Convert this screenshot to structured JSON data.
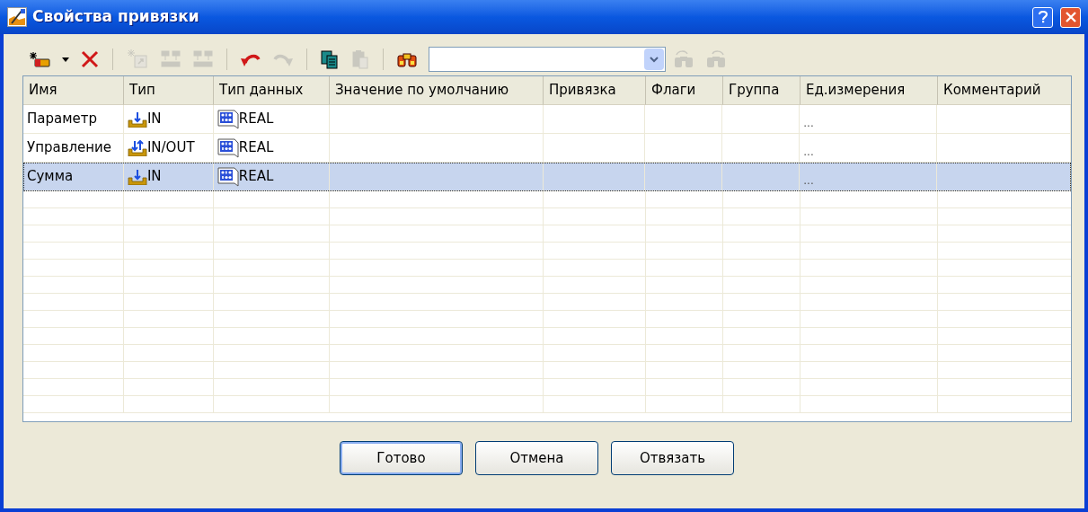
{
  "window": {
    "title": "Свойства привязки"
  },
  "toolbar": [
    {
      "kind": "new",
      "disabled": false
    },
    {
      "kind": "dropdown",
      "disabled": false
    },
    {
      "kind": "delete",
      "disabled": false
    },
    {
      "kind": "separator"
    },
    {
      "kind": "import",
      "disabled": true
    },
    {
      "kind": "group",
      "disabled": true
    },
    {
      "kind": "ungroup",
      "disabled": true
    },
    {
      "kind": "separator"
    },
    {
      "kind": "undo",
      "disabled": false
    },
    {
      "kind": "redo",
      "disabled": true
    },
    {
      "kind": "separator"
    },
    {
      "kind": "copy",
      "disabled": false
    },
    {
      "kind": "paste",
      "disabled": true
    },
    {
      "kind": "separator"
    },
    {
      "kind": "find",
      "disabled": false
    },
    {
      "kind": "search-field",
      "disabled": false
    },
    {
      "kind": "find-prev",
      "disabled": true
    },
    {
      "kind": "find-next",
      "disabled": true
    }
  ],
  "table": {
    "columns": [
      "Имя",
      "Тип",
      "Тип данных",
      "Значение по умолчанию",
      "Привязка",
      "Флаги",
      "Группа",
      "Ед.измерения",
      "Комментарий"
    ],
    "rows": [
      {
        "name": "Параметр",
        "kind": "in",
        "type": "IN",
        "data_type": "REAL",
        "unit": "...",
        "selected": false
      },
      {
        "name": "Управление",
        "kind": "inout",
        "type": "IN/OUT",
        "data_type": "REAL",
        "unit": "...",
        "selected": false
      },
      {
        "name": "Сумма",
        "kind": "in",
        "type": "IN",
        "data_type": "REAL",
        "unit": "...",
        "selected": true
      }
    ]
  },
  "buttons": [
    {
      "label": "Готово",
      "default": true
    },
    {
      "label": "Отмена",
      "default": false
    },
    {
      "label": "Отвязать",
      "default": false
    }
  ]
}
